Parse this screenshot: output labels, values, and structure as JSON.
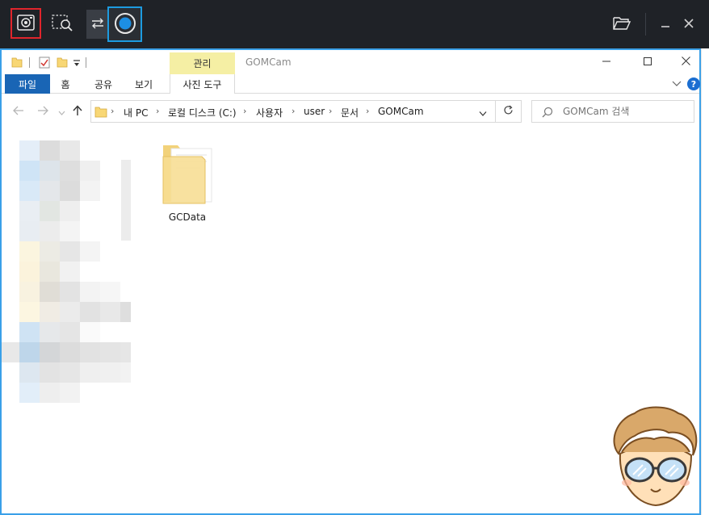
{
  "gom_toolbar": {
    "capture_label": "",
    "record_label": ""
  },
  "explorer": {
    "window_title": "GOMCam",
    "contextual_tab_title": "관리",
    "ribbon_tabs": {
      "file": "파일",
      "home": "홈",
      "share": "공유",
      "view": "보기",
      "photo_tools": "사진 도구"
    },
    "breadcrumb": [
      "내 PC",
      "로컬 디스크 (C:)",
      "사용자",
      "user",
      "문서",
      "GOMCam"
    ],
    "search_placeholder": "GOMCam 검색",
    "help_label": "?",
    "items": [
      {
        "name": "GCData",
        "type": "folder"
      }
    ]
  },
  "colors": {
    "toolbar_bg": "#1f2227",
    "capture_border": "#e0252c",
    "record_border": "#1d9be0",
    "file_tab": "#1965b5",
    "contextual_tab": "#f5efa4",
    "window_border": "#3aa0e8"
  },
  "icons": {
    "capture": "camera-icon",
    "region": "region-zoom-icon",
    "switch": "swap-arrows-icon",
    "record": "record-icon",
    "folder": "folder-open-icon",
    "minimize": "minimize-icon",
    "close": "close-icon"
  }
}
